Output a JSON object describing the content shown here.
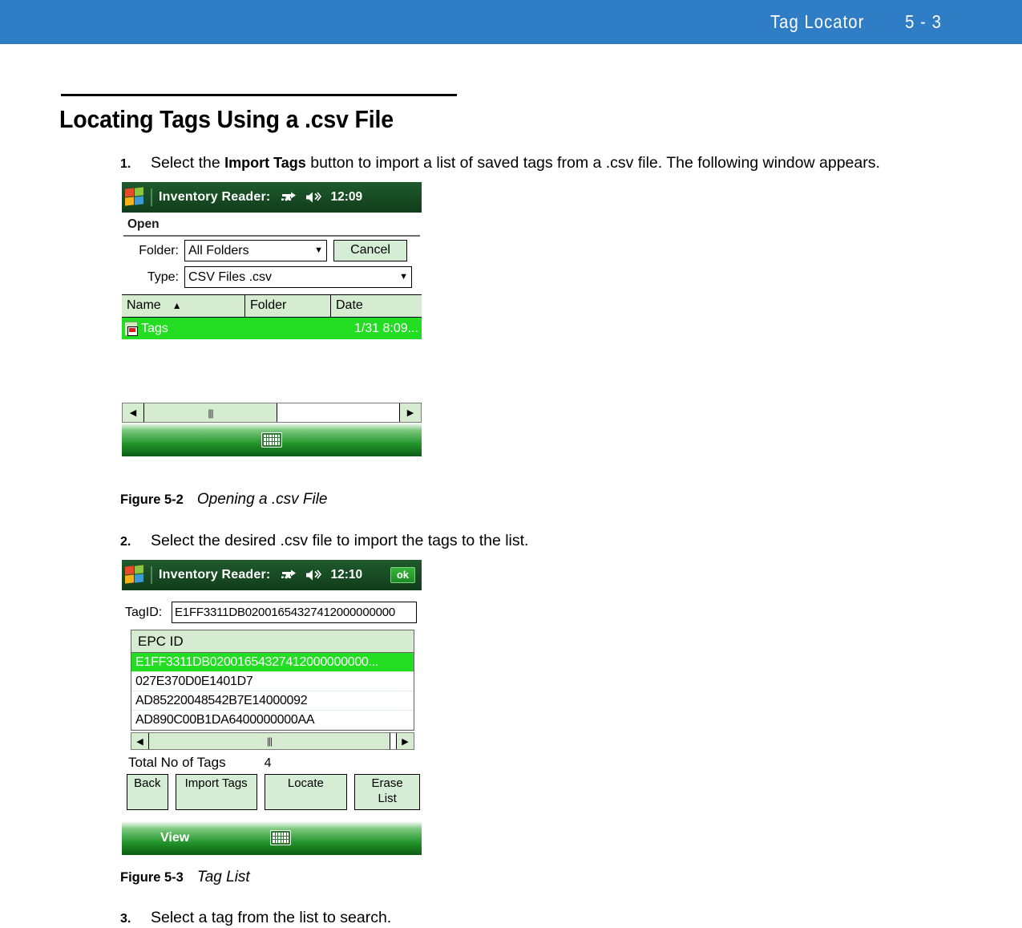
{
  "header": {
    "title": "Tag Locator",
    "page_number": "5 - 3"
  },
  "section": {
    "title": "Locating Tags Using a .csv File"
  },
  "steps": [
    {
      "number": "1.",
      "text_before": "Select the ",
      "bold": "Import Tags",
      "text_after": " button to import a list of saved tags from a .csv file. The following window appears."
    },
    {
      "number": "2.",
      "text_before": "Select the desired .csv file to import the tags to the list.",
      "bold": "",
      "text_after": ""
    },
    {
      "number": "3.",
      "text_before": "Select a tag from the list to search.",
      "bold": "",
      "text_after": ""
    }
  ],
  "figures": [
    {
      "label": "Figure 5-2",
      "caption": "Opening a .csv File"
    },
    {
      "label": "Figure 5-3",
      "caption": "Tag List"
    }
  ],
  "screen_open": {
    "titlebar": {
      "app_title": "Inventory Reader:",
      "time": "12:09",
      "network_icon": "network-icon",
      "speaker_icon": "speaker-icon",
      "windows_icon": "windows-flag-icon"
    },
    "dialog_title": "Open",
    "folder_label": "Folder:",
    "folder_value": "All Folders",
    "cancel_label": "Cancel",
    "type_label": "Type:",
    "type_value": "CSV Files .csv",
    "grid_headers": [
      "Name",
      "Folder",
      "Date"
    ],
    "sort_indicator": "▲",
    "rows": [
      {
        "name": "Tags",
        "folder": "",
        "date": "1/31 8:09..."
      }
    ],
    "scrollbar": {
      "left_arrow": "◀",
      "right_arrow": "▶",
      "thumb_glyph": "|||"
    },
    "taskbar": {
      "left_label": "",
      "keyboard_icon": "keyboard-icon"
    }
  },
  "screen_taglist": {
    "titlebar": {
      "app_title": "Inventory Reader:",
      "time": "12:10",
      "ok_label": "ok",
      "network_icon": "network-icon",
      "speaker_icon": "speaker-icon",
      "windows_icon": "windows-flag-icon"
    },
    "tagid_label": "TagID:",
    "tagid_value": "E1FF3311DB02001654327412000000000",
    "list_header": "EPC ID",
    "epc_rows": [
      "E1FF3311DB02001654327412000000000...",
      "027E370D0E1401D7",
      "AD85220048542B7E14000092",
      "AD890C00B1DA6400000000AA"
    ],
    "scrollbar": {
      "left_arrow": "◀",
      "right_arrow": "▶",
      "thumb_glyph": "|||"
    },
    "total_label": "Total No of Tags",
    "total_value": "4",
    "buttons": [
      "Back",
      "Import Tags",
      "Locate",
      "Erase List"
    ],
    "taskbar": {
      "left_label": "View",
      "keyboard_icon": "keyboard-icon"
    }
  },
  "colors": {
    "header_blue": "#2f7dc4",
    "titlebar_green": "#1d5329",
    "selection_green": "#22dd22",
    "control_green": "#d5ecd0"
  }
}
